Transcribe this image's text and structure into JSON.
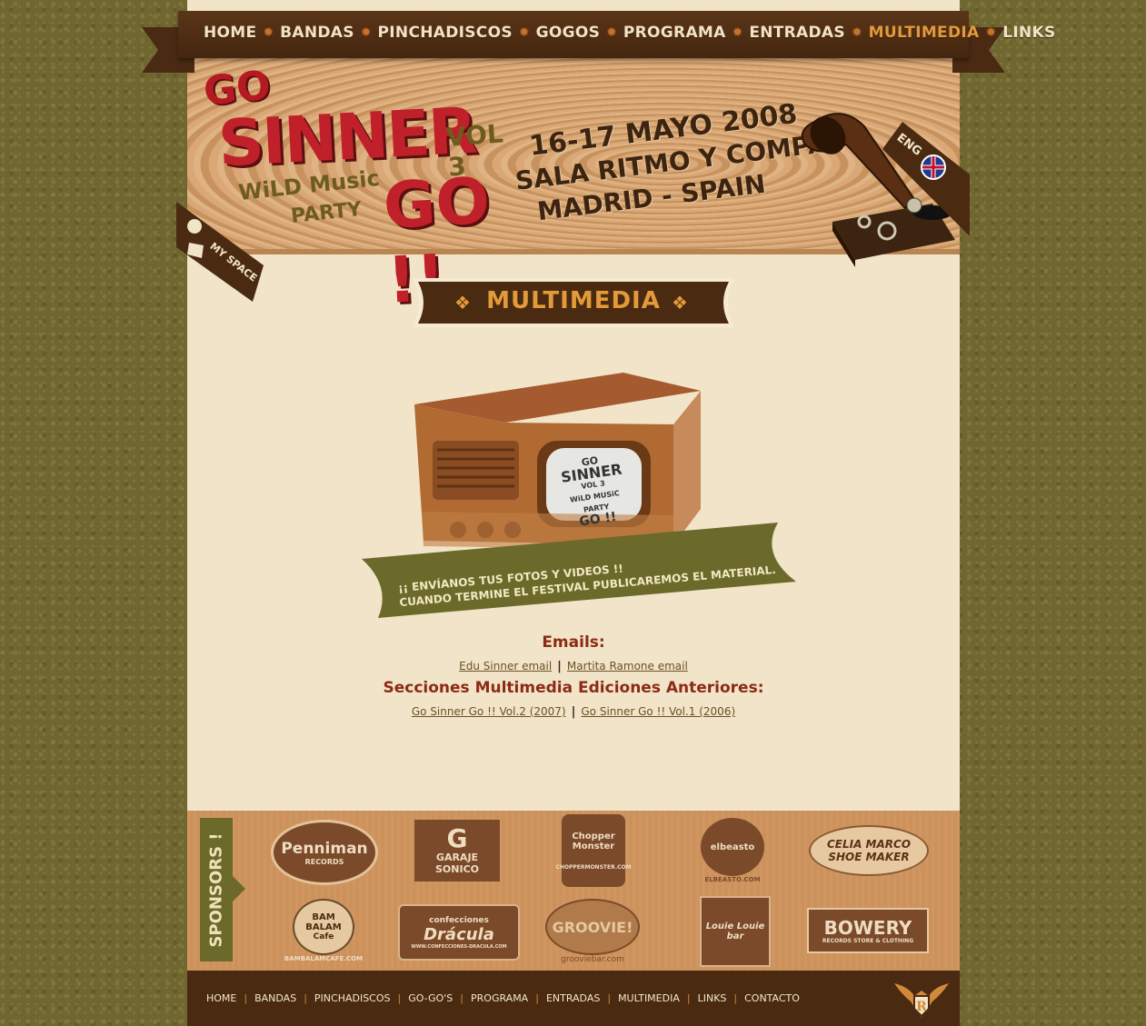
{
  "nav": {
    "items": [
      {
        "label": "HOME"
      },
      {
        "label": "BANDAS"
      },
      {
        "label": "PINCHADISCOS"
      },
      {
        "label": "GOGOS"
      },
      {
        "label": "PROGRAMA"
      },
      {
        "label": "ENTRADAS"
      },
      {
        "label": "MULTIMEDIA",
        "active": true
      },
      {
        "label": "LINKS"
      }
    ],
    "separator_icon": "star-icon"
  },
  "header": {
    "logo": {
      "go_top": "GO",
      "sinner": "SINNER",
      "vol": "VOL 3",
      "wild": "WiLD Music",
      "party": "PARTY",
      "go_bottom": "GO !!"
    },
    "event": {
      "dates": "16-17 MAYO 2008",
      "venue": "SALA RITMO Y COMPAS",
      "city": "MADRID - SPAIN"
    },
    "myspace_label": "MY SPACE",
    "lang_label": "ENG"
  },
  "section": {
    "title": "MULTIMEDIA"
  },
  "radio": {
    "screen": {
      "go": "GO",
      "sinner": "SINNER",
      "vol": "VOL 3",
      "wild": "WiLD MUSiC",
      "party": "PARTY",
      "go2": "GO !!"
    },
    "banner_line1": "¡¡ ENVÍANOS TUS FOTOS Y VIDEOS !!",
    "banner_line2": "CUANDO TERMINE EL FESTIVAL PUBLICAREMOS EL MATERIAL."
  },
  "emails": {
    "title": "Emails:",
    "links": [
      "Edu Sinner email",
      "Martita Ramone email"
    ]
  },
  "previous": {
    "title": "Secciones Multimedia Ediciones Anteriores:",
    "links": [
      "Go Sinner Go !! Vol.2 (2007)",
      "Go Sinner Go !! Vol.1 (2006)"
    ]
  },
  "sponsors": {
    "label": "SPONSORS !",
    "items": [
      {
        "name": "Penniman",
        "sub": "RECORDS"
      },
      {
        "name": "GARAJE",
        "sub": "SONICO",
        "mark": "G"
      },
      {
        "name": "Chopper Monster",
        "sub": "CHOPPERMONSTER.COM"
      },
      {
        "name": "elbeasto",
        "sub": "ELBEASTO.COM"
      },
      {
        "name": "CELIA MARCO",
        "sub": "SHOE MAKER"
      },
      {
        "name": "BAM BALAM",
        "sub": "BAMBALAMCAFE.COM",
        "extra": "Cafe"
      },
      {
        "name": "Drácula",
        "sub": "WWW.CONFECCIONES-DRACULA.COM",
        "top": "confecciones"
      },
      {
        "name": "GROOVIE!",
        "sub": "grooviebar.com"
      },
      {
        "name": "Louie Louie",
        "sub": "bar"
      },
      {
        "name": "BOWERY",
        "sub": "RECORDS STORE & CLOTHING"
      }
    ]
  },
  "footer": {
    "items": [
      "HOME",
      "BANDAS",
      "PINCHADISCOS",
      "GO-GO'S",
      "PROGRAMA",
      "ENTRADAS",
      "MULTIMEDIA",
      "LINKS",
      "CONTACTO"
    ]
  },
  "colors": {
    "brown_dark": "#4a2a10",
    "accent_orange": "#e39a3a",
    "logo_red": "#c0202a",
    "olive": "#6b6a2a",
    "link_brown": "#6a5324",
    "heading_red": "#8c2a16"
  }
}
